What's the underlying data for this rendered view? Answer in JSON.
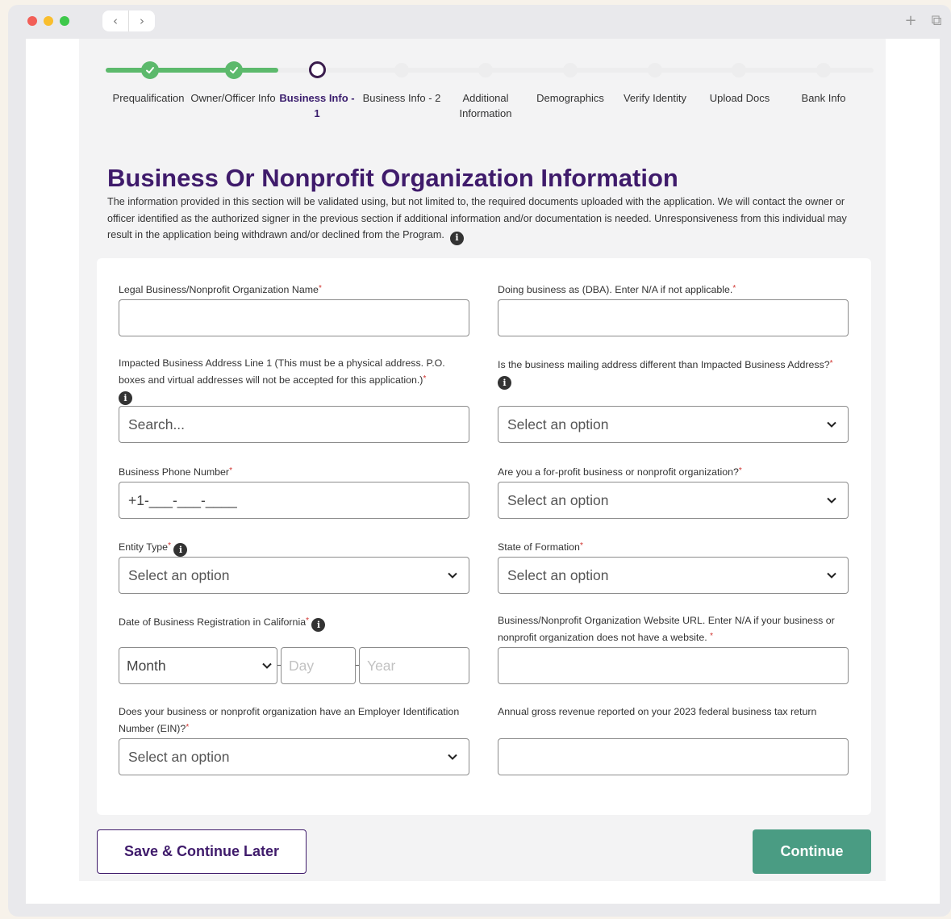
{
  "stepper": {
    "steps": [
      {
        "label": "Prequalification",
        "status": "done"
      },
      {
        "label": "Owner/Officer Info",
        "status": "done"
      },
      {
        "label": "Business Info - 1",
        "status": "current"
      },
      {
        "label": "Business Info - 2",
        "status": "todo"
      },
      {
        "label": "Additional Information",
        "status": "todo"
      },
      {
        "label": "Demographics",
        "status": "todo"
      },
      {
        "label": "Verify Identity",
        "status": "todo"
      },
      {
        "label": "Upload Docs",
        "status": "todo"
      },
      {
        "label": "Bank Info",
        "status": "todo"
      }
    ]
  },
  "page": {
    "title": "Business Or Nonprofit Organization Information",
    "description": "The information provided in this section will be validated using, but not limited to, the required documents uploaded with the application. We will contact the owner or officer identified as the authorized signer in the previous section if additional information and/or documentation is needed. Unresponsiveness from this individual may result in the application being withdrawn and/or declined from the Program."
  },
  "form": {
    "legal_name": {
      "label": "Legal Business/Nonprofit Organization Name",
      "required": "*",
      "value": ""
    },
    "dba": {
      "label": "Doing business as (DBA). Enter N/A if not applicable.",
      "required": "*",
      "value": ""
    },
    "address": {
      "label": "Impacted Business Address Line 1 (This must be a physical address. P.O. boxes and virtual addresses will not be accepted for this application.)",
      "required": "*",
      "placeholder": "Search..."
    },
    "mailing_different": {
      "label": "Is the business mailing address different than Impacted Business Address?",
      "required": "*",
      "value": "Select an option"
    },
    "phone": {
      "label": "Business Phone Number",
      "required": "*",
      "value": "+1-___-___-____"
    },
    "for_profit": {
      "label": "Are you a for-profit business or nonprofit organization?",
      "required": "*",
      "value": "Select an option"
    },
    "entity_type": {
      "label": "Entity Type",
      "required": "*",
      "value": "Select an option"
    },
    "state_formation": {
      "label": "State of Formation",
      "required": "*",
      "value": "Select an option"
    },
    "registration_date": {
      "label": "Date of Business Registration in California",
      "required": "*",
      "month": "Month",
      "day": "Day",
      "year": "Year"
    },
    "website": {
      "label": "Business/Nonprofit Organization Website URL. Enter N/A if your business or nonprofit organization does not have a website.",
      "required": "*",
      "value": ""
    },
    "ein": {
      "label": "Does your business or nonprofit organization have an Employer Identification Number (EIN)?",
      "required": "*",
      "value": "Select an option"
    },
    "revenue": {
      "label": "Annual gross revenue reported on your 2023 federal business tax return",
      "value": ""
    }
  },
  "actions": {
    "save_label": "Save & Continue Later",
    "continue_label": "Continue"
  },
  "colors": {
    "primary": "#3f1b6b",
    "success": "#5cb96c",
    "continue": "#4a9c83",
    "required": "#d0312d"
  }
}
